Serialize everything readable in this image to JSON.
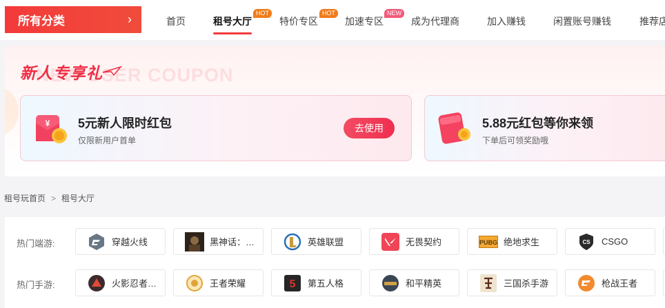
{
  "nav": {
    "category_label": "所有分类",
    "items": [
      {
        "label": "首页"
      },
      {
        "label": "租号大厅",
        "badge": "HOT"
      },
      {
        "label": "特价专区",
        "badge": "HOT"
      },
      {
        "label": "加速专区",
        "badge": "NEW"
      },
      {
        "label": "成为代理商"
      },
      {
        "label": "加入赚钱"
      },
      {
        "label": "闲置账号赚钱"
      },
      {
        "label": "推荐店"
      }
    ]
  },
  "banner": {
    "title": "新人专享礼",
    "subtitle": "NEW USER COUPON",
    "coupons": [
      {
        "amount": "5元新人限时红包",
        "note": "仅限新用户首单",
        "button": "去使用"
      },
      {
        "amount": "5.88元红包等你来领",
        "note": "下单后可领奖励哦"
      }
    ]
  },
  "breadcrumb": {
    "home": "租号玩首页",
    "sep": ">",
    "current": "租号大厅"
  },
  "games": {
    "pc_label": "热门端游:",
    "mobile_label": "热门手游:",
    "pc": [
      {
        "name": "穿越火线",
        "icon": "crossfire-icon"
      },
      {
        "name": "黑神话：悟空",
        "icon": "black-myth-icon"
      },
      {
        "name": "英雄联盟",
        "icon": "lol-icon"
      },
      {
        "name": "无畏契约",
        "icon": "valorant-icon"
      },
      {
        "name": "绝地求生",
        "icon": "pubg-icon"
      },
      {
        "name": "CSGO",
        "icon": "csgo-icon"
      }
    ],
    "mobile": [
      {
        "name": "火影忍者手游",
        "icon": "naruto-icon"
      },
      {
        "name": "王者荣耀",
        "icon": "honor-of-kings-icon"
      },
      {
        "name": "第五人格",
        "icon": "identity-v-icon"
      },
      {
        "name": "和平精英",
        "icon": "peace-elite-icon"
      },
      {
        "name": "三国杀手游",
        "icon": "sanguosha-icon"
      },
      {
        "name": "枪战王者",
        "icon": "cf-mobile-icon"
      }
    ]
  }
}
